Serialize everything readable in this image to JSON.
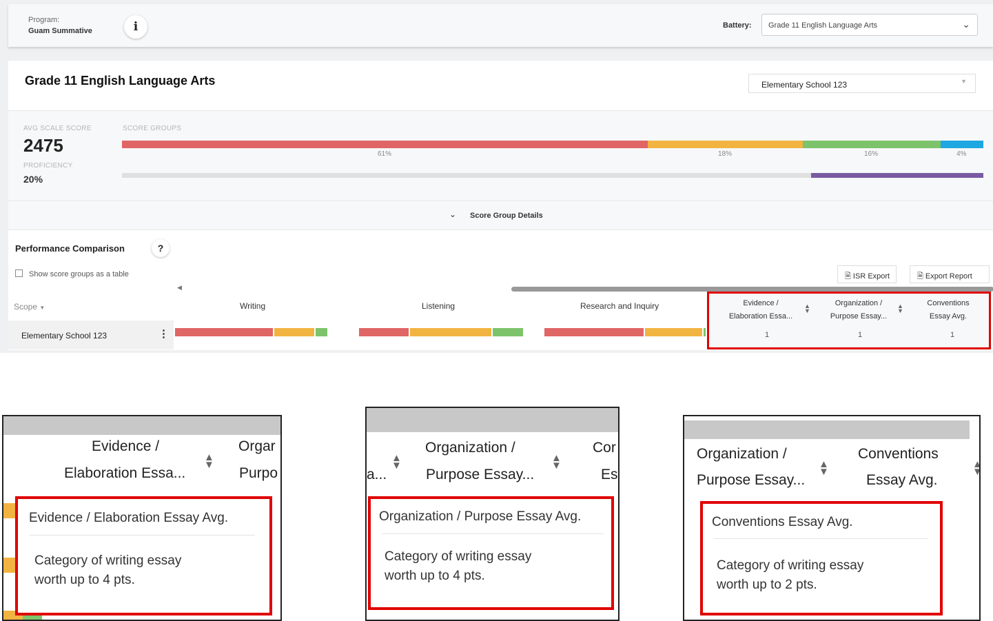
{
  "header": {
    "program_label": "Program:",
    "program_value": "Guam Summative",
    "info_icon": "info-icon",
    "battery_label": "Battery:",
    "battery_value": "Grade 11 English Language Arts"
  },
  "report": {
    "title": "Grade 11 English Language Arts",
    "school_select_value": "Elementary School 123",
    "avg_scale_score_label": "AVG SCALE SCORE",
    "avg_scale_score": "2475",
    "proficiency_label": "PROFICIENCY",
    "proficiency_value": "20%",
    "proficiency_fraction": 0.2,
    "score_groups_label": "SCORE GROUPS",
    "score_groups": [
      {
        "pct_label": "61%",
        "fraction": 0.61,
        "color": "#e06565"
      },
      {
        "pct_label": "18%",
        "fraction": 0.18,
        "color": "#f2b441"
      },
      {
        "pct_label": "16%",
        "fraction": 0.16,
        "color": "#7dc36b"
      },
      {
        "pct_label": "4%",
        "fraction": 0.05,
        "color": "#1ea7e1"
      }
    ],
    "proficiency_color": "#7a5aa3",
    "score_group_details": "Score Group Details"
  },
  "comparison": {
    "title": "Performance Comparison",
    "help_icon": "?",
    "show_table_label": "Show score groups as a table",
    "isr_export": "ISR Export",
    "export_report": "Export Report",
    "scope_header": "Scope",
    "row_label": "Elementary School 123",
    "columns": [
      {
        "label": "Writing",
        "segments": [
          0.6,
          0.25,
          0.08
        ]
      },
      {
        "label": "Listening",
        "segments": [
          0.31,
          0.5,
          0.19
        ]
      },
      {
        "label": "Research and Inquiry",
        "segments": [
          0.62,
          0.36,
          0.02
        ]
      }
    ],
    "essay_columns": [
      {
        "line1": "Evidence /",
        "line2": "Elaboration Essa...",
        "value": "1"
      },
      {
        "line1": "Organization /",
        "line2": "Purpose Essay...",
        "value": "1"
      },
      {
        "line1": "Conventions",
        "line2": "Essay Avg.",
        "value": "1"
      }
    ]
  },
  "callouts": [
    {
      "hdr_a1": "Evidence /",
      "hdr_a2": "Elaboration Essa...",
      "hdr_b1": "Orgar",
      "hdr_b2": "Purpo",
      "tip_title": "Evidence / Elaboration Essay Avg.",
      "tip_body1": "Category of writing essay",
      "tip_body2": "worth up to 4 pts."
    },
    {
      "hdr_a2": "a...",
      "hdr_b1": "Organization /",
      "hdr_b2": "Purpose Essay...",
      "hdr_c1": "Cor",
      "hdr_c2": "Es",
      "tip_title": "Organization / Purpose Essay Avg.",
      "tip_body1": "Category of writing essay",
      "tip_body2": "worth up to 4 pts."
    },
    {
      "hdr_a1": "Organization /",
      "hdr_a2": "Purpose Essay...",
      "hdr_b1": "Conventions",
      "hdr_b2": "Essay Avg.",
      "tip_title": "Conventions Essay Avg.",
      "tip_body1": "Category of writing essay",
      "tip_body2": "worth up to 2 pts."
    }
  ]
}
